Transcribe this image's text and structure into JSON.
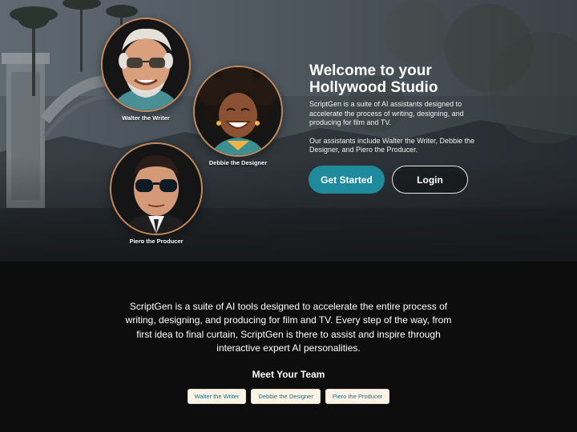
{
  "hero": {
    "title": "Welcome to your Hollywood Studio",
    "description": "ScriptGen is a suite of AI assistants designed to accelerate the process of writing, designing, and producing for film and TV.",
    "assistants_note": "Our assistants include Walter the Writer, Debbie the Designer, and Piero the Producer.",
    "get_started_label": "Get Started",
    "login_label": "Login",
    "avatars": [
      {
        "label": "Walter the Writer"
      },
      {
        "label": "Debbie the Designer"
      },
      {
        "label": "Piero the Producer"
      }
    ]
  },
  "intro": {
    "text": "ScriptGen is a suite of AI tools designed to accelerate the entire process of writing, designing, and producing for film and TV. Every step of the way, from first idea to final curtain, ScriptGen is there to assist and inspire through interactive expert AI personalities."
  },
  "team": {
    "heading": "Meet Your Team",
    "members": [
      "Walter the Writer",
      "Debbie the Designer",
      "Piero the Producer"
    ]
  },
  "colors": {
    "primary_button": "#1f8a9c",
    "chip_background": "#fbf4e6",
    "chip_text": "#1b6c80",
    "avatar_ring": "#c48a5a",
    "page_background": "#0d0d0d"
  }
}
